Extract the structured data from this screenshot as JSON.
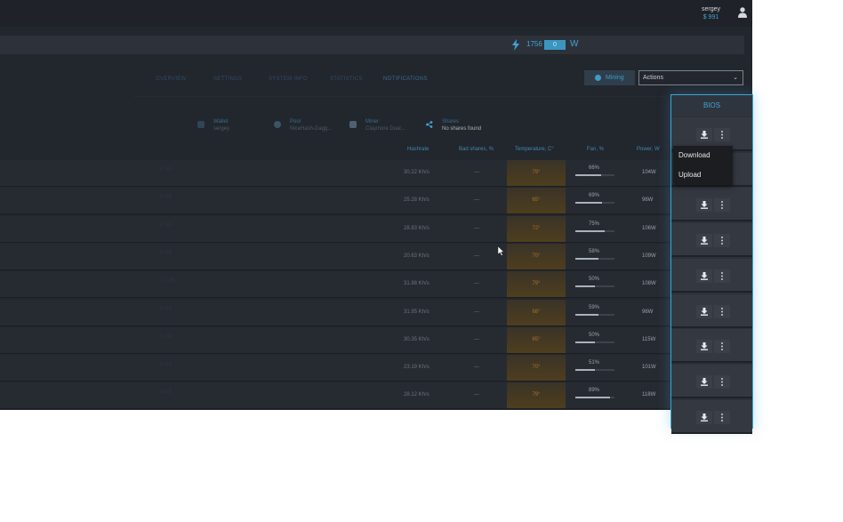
{
  "user": {
    "name": "sergey",
    "balance": "$ 991"
  },
  "power": {
    "value": "1756",
    "box": "0",
    "unit": "W"
  },
  "tabs": [
    "OVERVIEW",
    "SETTINGS",
    "SYSTEM INFO",
    "STATISTICS",
    "NOTIFICATIONS"
  ],
  "mining_button": "Mining",
  "actions_select": "Actions",
  "info": [
    {
      "key": "Wallet",
      "value": "sergey"
    },
    {
      "key": "Pool",
      "value": "NiceHash-Dagg..."
    },
    {
      "key": "Miner",
      "value": "Claymore Dual..."
    },
    {
      "key": "Shares",
      "value": "No shares found"
    }
  ],
  "columns": [
    "Hashrate",
    "Bad shares, %",
    "Temperature, C°",
    "Fan, %",
    "Power, W"
  ],
  "rows": [
    {
      "gpu": "8 GB",
      "hashrate": "30.22 Kh/s",
      "bad": "—",
      "temp": "79°",
      "fan": "66%",
      "fan_pct": 66,
      "power": "104W"
    },
    {
      "gpu": "4 GB",
      "hashrate": "25.28 Kh/s",
      "bad": "—",
      "temp": "65°",
      "fan": "69%",
      "fan_pct": 69,
      "power": "96W"
    },
    {
      "gpu": "8 GB",
      "hashrate": "28.83 Kh/s",
      "bad": "—",
      "temp": "72°",
      "fan": "75%",
      "fan_pct": 75,
      "power": "106W"
    },
    {
      "gpu": "8 GB",
      "hashrate": "20.63 Kh/s",
      "bad": "—",
      "temp": "70°",
      "fan": "58%",
      "fan_pct": 58,
      "power": "109W"
    },
    {
      "gpu": "11 GB",
      "hashrate": "31.88 Kh/s",
      "bad": "—",
      "temp": "79°",
      "fan": "50%",
      "fan_pct": 50,
      "power": "108W"
    },
    {
      "gpu": "8 GB",
      "hashrate": "31.95 Kh/s",
      "bad": "—",
      "temp": "68°",
      "fan": "59%",
      "fan_pct": 59,
      "power": "96W"
    },
    {
      "gpu": "8 GB",
      "hashrate": "30.35 Kh/s",
      "bad": "—",
      "temp": "65°",
      "fan": "50%",
      "fan_pct": 50,
      "power": "115W"
    },
    {
      "gpu": "4 GB",
      "hashrate": "23.19 Kh/s",
      "bad": "—",
      "temp": "70°",
      "fan": "51%",
      "fan_pct": 51,
      "power": "101W"
    },
    {
      "gpu": "4 GB",
      "hashrate": "28.12 Kh/s",
      "bad": "—",
      "temp": "79°",
      "fan": "89%",
      "fan_pct": 89,
      "power": "118W"
    }
  ],
  "bios": {
    "title": "BIOS",
    "menu": [
      "Download",
      "Upload"
    ]
  },
  "colors": {
    "accent": "#3fa6d4",
    "temp": "#a8712a",
    "panel_border": "#3aa6cf"
  }
}
